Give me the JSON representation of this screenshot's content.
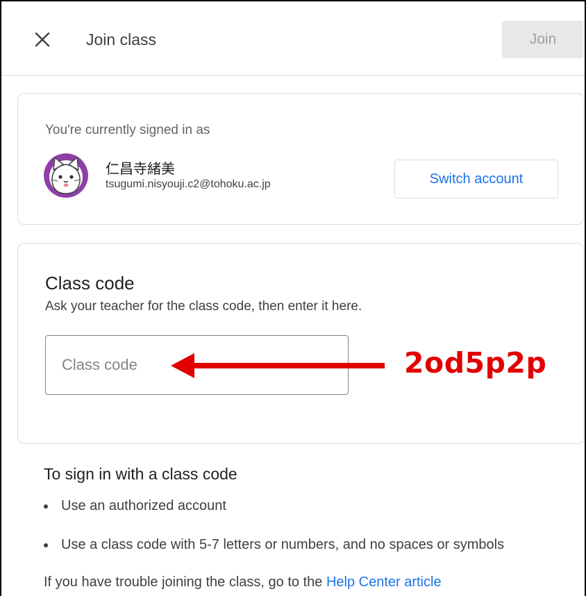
{
  "header": {
    "title": "Join class",
    "join_label": "Join"
  },
  "account": {
    "signed_in_label": "You're currently signed in as",
    "name": "仁昌寺緒美",
    "email": "tsugumi.nisyouji.c2@tohoku.ac.jp",
    "switch_label": "Switch account"
  },
  "class_code": {
    "title": "Class code",
    "subtitle": "Ask your teacher for the class code, then enter it here.",
    "placeholder": "Class code",
    "value": ""
  },
  "annotation": {
    "code": "2od5p2p",
    "color": "#e00000"
  },
  "instructions": {
    "title": "To sign in with a class code",
    "bullets": [
      "Use an authorized account",
      "Use a class code with 5-7 letters or numbers, and no spaces or symbols"
    ],
    "help_prefix": "If you have trouble joining the class, go to the ",
    "help_link": "Help Center article"
  },
  "colors": {
    "accent": "#1a73e8",
    "avatar_bg": "#8e3fa6"
  },
  "icons": {
    "close": "close-icon",
    "avatar": "cat-avatar-icon",
    "arrow": "left-arrow-icon"
  }
}
